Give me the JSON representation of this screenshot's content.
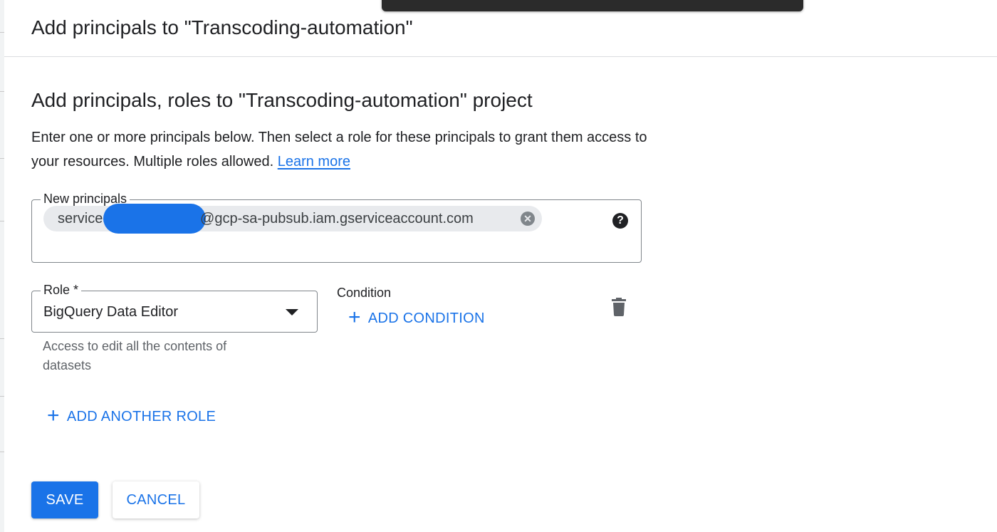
{
  "dialog": {
    "title": "Add principals to \"Transcoding-automation\""
  },
  "section": {
    "title": "Add principals, roles to \"Transcoding-automation\" project",
    "description": "Enter one or more principals below. Then select a role for these principals to grant them access to your resources. Multiple roles allowed.",
    "learn_more_label": "Learn more"
  },
  "principals": {
    "label": "New principals",
    "chip_prefix": "service-",
    "chip_suffix": "@gcp-sa-pubsub.iam.gserviceaccount.com",
    "help_icon": "help-circle-icon",
    "remove_icon": "cancel-circle-icon"
  },
  "role": {
    "label": "Role *",
    "value": "BigQuery Data Editor",
    "helper": "Access to edit all the contents of datasets"
  },
  "condition": {
    "label": "Condition",
    "add_label": "ADD CONDITION"
  },
  "add_another_role_label": "ADD ANOTHER ROLE",
  "actions": {
    "save_label": "SAVE",
    "cancel_label": "CANCEL"
  },
  "colors": {
    "accent": "#1a73e8",
    "text": "#202124",
    "chip_bg": "#e8eaed"
  }
}
